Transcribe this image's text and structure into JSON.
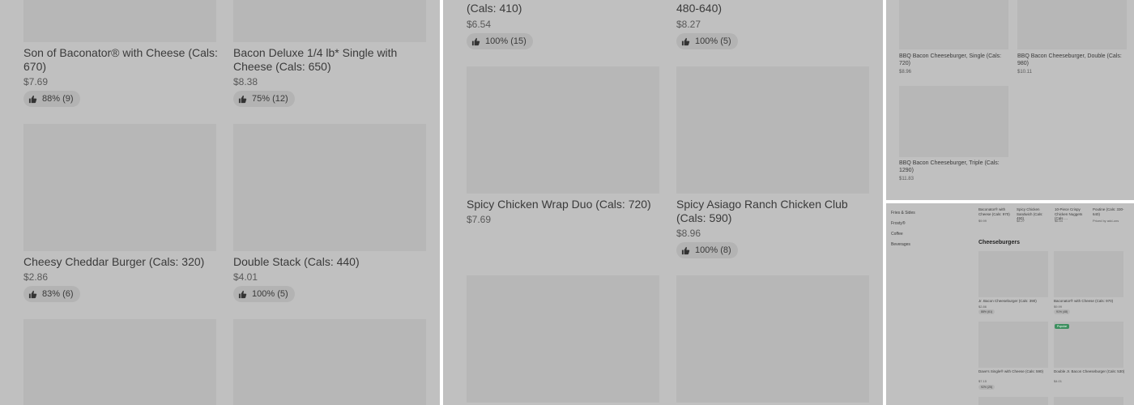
{
  "panel_a": {
    "items": [
      {
        "title": "Son of Baconator® with Cheese (Cals: 670)",
        "price": "$7.69",
        "rating": "88% (9)"
      },
      {
        "title": "Bacon Deluxe 1/4 lb* Single with Cheese (Cals: 650)",
        "price": "$8.38",
        "rating": "75% (12)"
      },
      {
        "title": "Cheesy Cheddar Burger (Cals: 320)",
        "price": "$2.86",
        "rating": "83% (6)"
      },
      {
        "title": "Double Stack (Cals: 440)",
        "price": "$4.01",
        "rating": "100% (5)"
      }
    ]
  },
  "panel_b": {
    "items": [
      {
        "title": "(Cals: 410)",
        "price": "$6.54",
        "rating": "100% (15)"
      },
      {
        "title": "480-640)",
        "price": "$8.27",
        "rating": "100% (5)"
      },
      {
        "title": "Spicy Chicken Wrap Duo (Cals: 720)",
        "price": "$7.69",
        "rating": ""
      },
      {
        "title": "Spicy Asiago Ranch Chicken Club (Cals: 590)",
        "price": "$8.96",
        "rating": "100% (8)"
      }
    ]
  },
  "panel_c": {
    "items": [
      {
        "title": "BBQ Bacon Cheeseburger, Single (Cals: 720)",
        "price": "$8.96"
      },
      {
        "title": "BBQ Bacon Cheeseburger, Double (Cals: 980)",
        "price": "$10.11"
      },
      {
        "title": "BBQ Bacon Cheeseburger, Triple (Cals: 1290)",
        "price": "$11.83"
      }
    ]
  },
  "panel_d": {
    "sidebar": [
      "Fries & Sides",
      "Frosty®",
      "Coffee",
      "Beverages"
    ],
    "top_items": [
      {
        "title": "Baconator® with Cheese (Cals: 970)",
        "price": "$9.99"
      },
      {
        "title": "Spicy Chicken Sandwich (Cals: 450)",
        "price": "$8.27"
      },
      {
        "title": "10-Piece Crispy Chicken Nuggets (Cals …",
        "price": "$6.54"
      },
      {
        "title": "Poutine (Cals: 330-640)",
        "price": "Priced by add-ons"
      }
    ],
    "section_title": "Cheeseburgers",
    "items": [
      {
        "title": "Jr. Bacon Cheeseburger (Cals: 390)",
        "price": "$2.86",
        "rating": "88% (61)"
      },
      {
        "title": "Baconator® with Cheese (Cals: 970)",
        "price": "$9.99",
        "rating": "91% (48)"
      },
      {
        "title": "Dave's Single® with Cheese (Cals: 590)",
        "price": "$7.15",
        "rating": "92% (25)"
      },
      {
        "title": "Double Jr. Bacon Cheeseburger (Cals: 530)",
        "price": "$4.01",
        "rating": ""
      }
    ],
    "badge": "Popular"
  },
  "colors": {
    "panel_bg": "#c0c0c0",
    "thumb_bg": "#b7b7b7",
    "badge_green": "#3d8f5f"
  },
  "icons": {
    "rating": "thumbs-up-icon"
  }
}
